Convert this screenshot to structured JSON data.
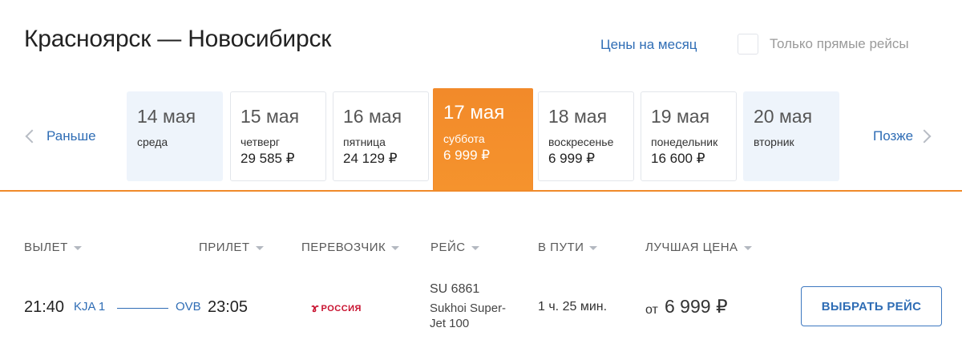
{
  "header": {
    "title": "Красноярск — Новосибирск",
    "month_prices_link": "Цены на месяц",
    "direct_only_label": "Только прямые рейсы",
    "direct_only_checked": false
  },
  "date_nav": {
    "prev_label": "Раньше",
    "next_label": "Позже",
    "days": [
      {
        "date": "14 мая",
        "weekday": "среда",
        "price": "",
        "state": "disabled"
      },
      {
        "date": "15 мая",
        "weekday": "четверг",
        "price": "29 585 ₽",
        "state": "normal"
      },
      {
        "date": "16 мая",
        "weekday": "пятница",
        "price": "24 129 ₽",
        "state": "normal"
      },
      {
        "date": "17 мая",
        "weekday": "суббота",
        "price": "6 999 ₽",
        "state": "active"
      },
      {
        "date": "18 мая",
        "weekday": "воскресенье",
        "price": "6 999 ₽",
        "state": "normal"
      },
      {
        "date": "19 мая",
        "weekday": "понедельник",
        "price": "16 600 ₽",
        "state": "normal"
      },
      {
        "date": "20 мая",
        "weekday": "вторник",
        "price": "",
        "state": "disabled"
      }
    ],
    "accent_color": "#f28a2a"
  },
  "columns": {
    "departure": "ВЫЛЕТ",
    "arrival": "ПРИЛЕТ",
    "carrier": "ПЕРЕВОЗЧИК",
    "flight": "РЕЙС",
    "duration": "В ПУТИ",
    "best_price": "ЛУЧШАЯ ЦЕНА"
  },
  "flight": {
    "dep_time": "21:40",
    "dep_airport": "KJA 1",
    "arr_airport": "OVB",
    "arr_time": "23:05",
    "carrier_name": "РОССИЯ",
    "carrier_logo_icon": "rossiya-airlines-logo",
    "flight_number": "SU 6861",
    "aircraft": "Sukhoi Super-Jet 100",
    "duration": "1 ч. 25 мин.",
    "price_prefix": "от",
    "price": "6 999 ₽",
    "select_button": "ВЫБРАТЬ РЕЙС"
  },
  "colors": {
    "link": "#2f6db5",
    "accent": "#f28a2a",
    "brand_red": "#c8102e"
  }
}
